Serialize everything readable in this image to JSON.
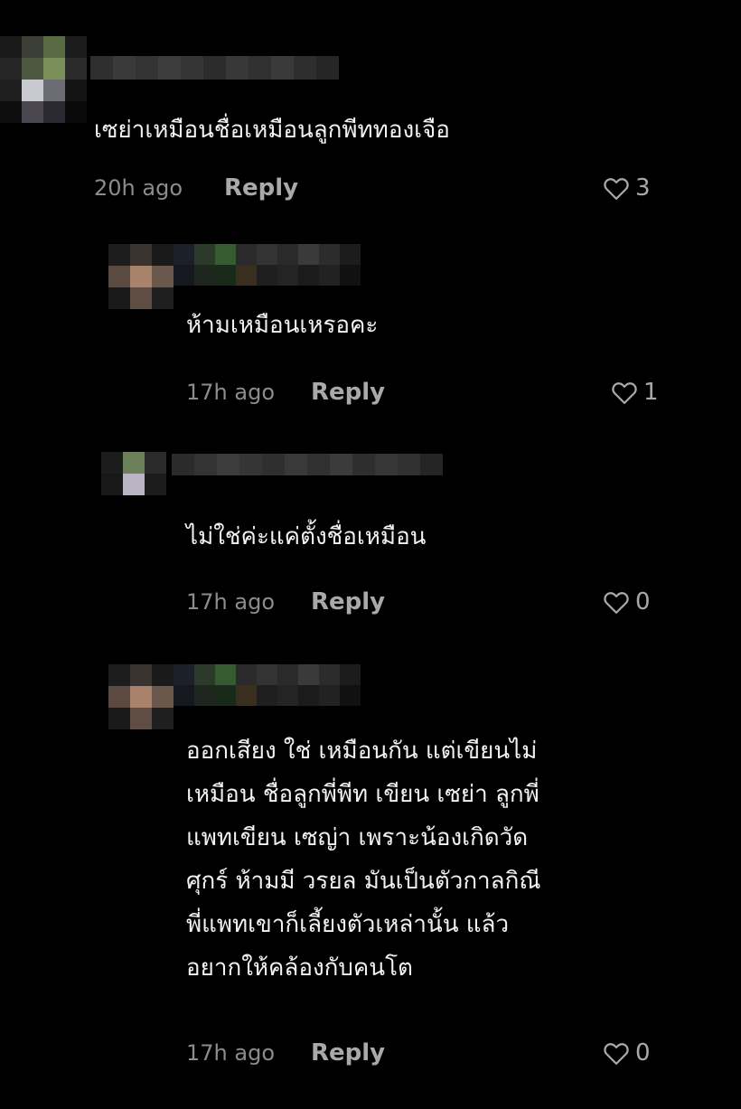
{
  "comments": [
    {
      "text": "เซย่าเหมือนชื่อเหมือนลูกพีททองเจือ",
      "time": "20h ago",
      "reply_label": "Reply",
      "likes": "3"
    },
    {
      "text": "ห้ามเหมือนเหรอคะ",
      "time": "17h ago",
      "reply_label": "Reply",
      "likes": "1"
    },
    {
      "text": "ไม่ใช่ค่ะแค่ตั้งชื่อเหมือน",
      "time": "17h ago",
      "reply_label": "Reply",
      "likes": "0"
    },
    {
      "text": "ออกเสียง ใช่ เหมือนกัน แต่เขียนไม่\nเหมือน ชื่อลูกพี่พีท เขียน เซย่า ลูกพี่\nแพทเขียน เซญ่า เพราะน้องเกิดวัด\nศุกร์ ห้ามมี วรยล มันเป็นตัวกาลกิณี\nพี่แพทเขาก็เลี้ยงตัวเหล่านั้น แล้ว\nอยากให้คล้องกับคนโต",
      "time": "17h ago",
      "reply_label": "Reply",
      "likes": "0"
    }
  ],
  "icons": {
    "like": "heart-outline-icon"
  },
  "colors": {
    "background": "#000000",
    "text": "#f2f2f2",
    "muted": "#8c8c8c"
  }
}
